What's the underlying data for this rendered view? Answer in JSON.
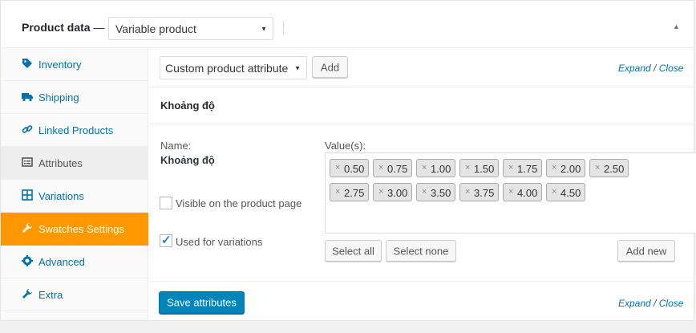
{
  "header": {
    "title": "Product data",
    "dash": "—",
    "product_type": "Variable product"
  },
  "sidebar": {
    "items": [
      {
        "label": "Inventory",
        "icon": "tag-icon"
      },
      {
        "label": "Shipping",
        "icon": "truck-icon"
      },
      {
        "label": "Linked Products",
        "icon": "link-icon"
      },
      {
        "label": "Attributes",
        "icon": "list-icon"
      },
      {
        "label": "Variations",
        "icon": "grid-icon"
      },
      {
        "label": "Swatches Settings",
        "icon": "wrench-icon"
      },
      {
        "label": "Advanced",
        "icon": "gear-icon"
      },
      {
        "label": "Extra",
        "icon": "wrench-icon"
      }
    ]
  },
  "toolbar": {
    "attribute_select": "Custom product attribute",
    "add_label": "Add",
    "expand_label": "Expand",
    "slash": "/",
    "close_label": "Close"
  },
  "attribute": {
    "heading": "Khoảng độ",
    "name_label": "Name:",
    "name_value": "Khoảng độ",
    "values_label": "Value(s):",
    "values": [
      "0.50",
      "0.75",
      "1.00",
      "1.50",
      "1.75",
      "2.00",
      "2.50",
      "2.75",
      "3.00",
      "3.50",
      "3.75",
      "4.00",
      "4.50"
    ],
    "remove_glyph": "×",
    "visible_label": "Visible on the product page",
    "visible_checked": false,
    "variations_label": "Used for variations",
    "variations_checked": true,
    "select_all": "Select all",
    "select_none": "Select none",
    "add_new": "Add new"
  },
  "footer": {
    "save_label": "Save attributes",
    "expand_label": "Expand",
    "slash": "/",
    "close_label": "Close"
  },
  "colors": {
    "accent_orange": "#ff9800",
    "link_blue": "#0073aa",
    "primary_blue": "#0085ba"
  }
}
